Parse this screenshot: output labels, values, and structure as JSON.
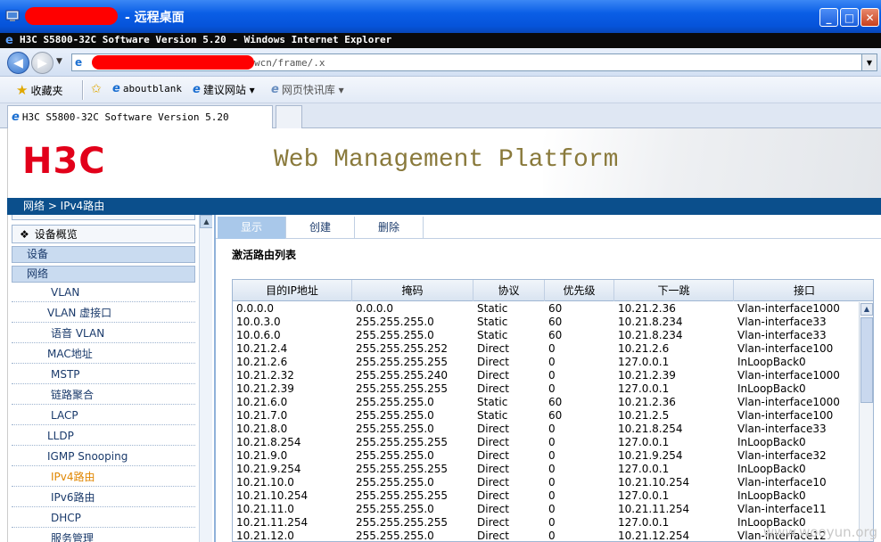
{
  "remote_desktop": {
    "title": "- 远程桌面",
    "buttons": [
      "_",
      "□",
      "✕"
    ]
  },
  "ie_window": {
    "title": "H3C S5800-32C Software Version 5.20 - Windows Internet Explorer"
  },
  "address_bar": {
    "url_visible": "wcn/frame/.x"
  },
  "favorites_bar": {
    "favorites_label": "收藏夹",
    "items": [
      "aboutblank",
      "建议网站 ▾",
      "网页快讯库 ▾"
    ]
  },
  "browser_tab": {
    "label": "H3C S5800-32C Software Version 5.20"
  },
  "header": {
    "logo": "H3C",
    "title": "Web Management Platform"
  },
  "breadcrumb": "网络 > IPv4路由",
  "sidebar": {
    "overview": "设备概览",
    "device": "设备",
    "network": "网络",
    "items": [
      "VLAN",
      "VLAN 虚接口",
      "语音 VLAN",
      "MAC地址",
      "MSTP",
      "链路聚合",
      "LACP",
      "LLDP",
      "IGMP Snooping",
      "IPv4路由",
      "IPv6路由",
      "DHCP",
      "服务管理"
    ],
    "active_index": 9
  },
  "main": {
    "tabs": [
      "显示",
      "创建",
      "删除"
    ],
    "section_title": "激活路由列表",
    "columns": [
      "目的IP地址",
      "掩码",
      "协议",
      "优先级",
      "下一跳",
      "接口"
    ],
    "rows": [
      [
        "0.0.0.0",
        "0.0.0.0",
        "Static",
        "60",
        "10.21.2.36",
        "Vlan-interface1000"
      ],
      [
        "10.0.3.0",
        "255.255.255.0",
        "Static",
        "60",
        "10.21.8.234",
        "Vlan-interface33"
      ],
      [
        "10.0.6.0",
        "255.255.255.0",
        "Static",
        "60",
        "10.21.8.234",
        "Vlan-interface33"
      ],
      [
        "10.21.2.4",
        "255.255.255.252",
        "Direct",
        "0",
        "10.21.2.6",
        "Vlan-interface100"
      ],
      [
        "10.21.2.6",
        "255.255.255.255",
        "Direct",
        "0",
        "127.0.0.1",
        "InLoopBack0"
      ],
      [
        "10.21.2.32",
        "255.255.255.240",
        "Direct",
        "0",
        "10.21.2.39",
        "Vlan-interface1000"
      ],
      [
        "10.21.2.39",
        "255.255.255.255",
        "Direct",
        "0",
        "127.0.0.1",
        "InLoopBack0"
      ],
      [
        "10.21.6.0",
        "255.255.255.0",
        "Static",
        "60",
        "10.21.2.36",
        "Vlan-interface1000"
      ],
      [
        "10.21.7.0",
        "255.255.255.0",
        "Static",
        "60",
        "10.21.2.5",
        "Vlan-interface100"
      ],
      [
        "10.21.8.0",
        "255.255.255.0",
        "Direct",
        "0",
        "10.21.8.254",
        "Vlan-interface33"
      ],
      [
        "10.21.8.254",
        "255.255.255.255",
        "Direct",
        "0",
        "127.0.0.1",
        "InLoopBack0"
      ],
      [
        "10.21.9.0",
        "255.255.255.0",
        "Direct",
        "0",
        "10.21.9.254",
        "Vlan-interface32"
      ],
      [
        "10.21.9.254",
        "255.255.255.255",
        "Direct",
        "0",
        "127.0.0.1",
        "InLoopBack0"
      ],
      [
        "10.21.10.0",
        "255.255.255.0",
        "Direct",
        "0",
        "10.21.10.254",
        "Vlan-interface10"
      ],
      [
        "10.21.10.254",
        "255.255.255.255",
        "Direct",
        "0",
        "127.0.0.1",
        "InLoopBack0"
      ],
      [
        "10.21.11.0",
        "255.255.255.0",
        "Direct",
        "0",
        "10.21.11.254",
        "Vlan-interface11"
      ],
      [
        "10.21.11.254",
        "255.255.255.255",
        "Direct",
        "0",
        "127.0.0.1",
        "InLoopBack0"
      ],
      [
        "10.21.12.0",
        "255.255.255.0",
        "Direct",
        "0",
        "10.21.12.254",
        "Vlan-interface12"
      ]
    ]
  },
  "watermark": "www.wooyun.org",
  "colors": {
    "brand_red": "#e2001a",
    "breadcrumb_blue": "#0b4f8c",
    "active_menu": "#e08600",
    "tab_active": "#a9c8ea"
  }
}
